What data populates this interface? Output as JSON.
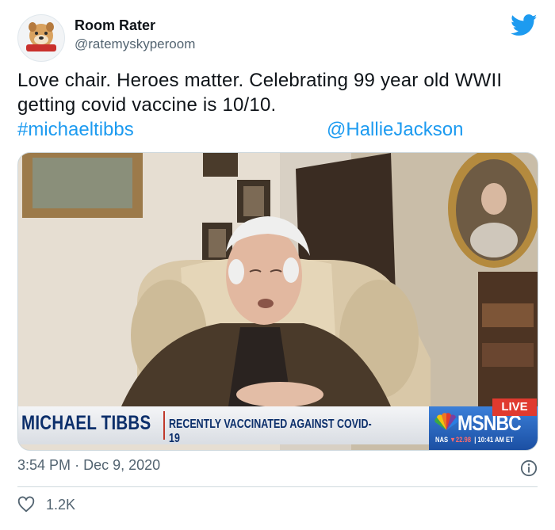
{
  "author": {
    "display_name": "Room Rater",
    "handle": "@ratemyskyperoom",
    "avatar_icon": "bulldog-avatar-icon"
  },
  "tweet": {
    "text": "Love chair. Heroes matter. Celebrating 99 year old WWII getting covid vaccine is 10/10.",
    "hashtag": "#michaeltibbs",
    "mention": "@HallieJackson"
  },
  "media": {
    "lower_third_name": "MICHAEL TIBBS",
    "lower_third_subtitle": "RECENTLY VACCINATED AGAINST COVID-19",
    "live_label": "LIVE",
    "network": "MSNBC",
    "ticker_label": "NAS",
    "ticker_value": "▼22.98",
    "ticker_time": "10:41 AM ET"
  },
  "meta": {
    "time": "3:54 PM",
    "separator": "·",
    "date": "Dec 9, 2020"
  },
  "actions": {
    "like_count": "1.2K"
  },
  "colors": {
    "twitter_blue": "#1d9bf0",
    "text_secondary": "#536471",
    "msnbc_red": "#e03a2f",
    "lower_third_navy": "#0c2f6b"
  },
  "icons": {
    "brand": "twitter-bird-icon",
    "info": "info-icon",
    "like": "heart-icon"
  }
}
